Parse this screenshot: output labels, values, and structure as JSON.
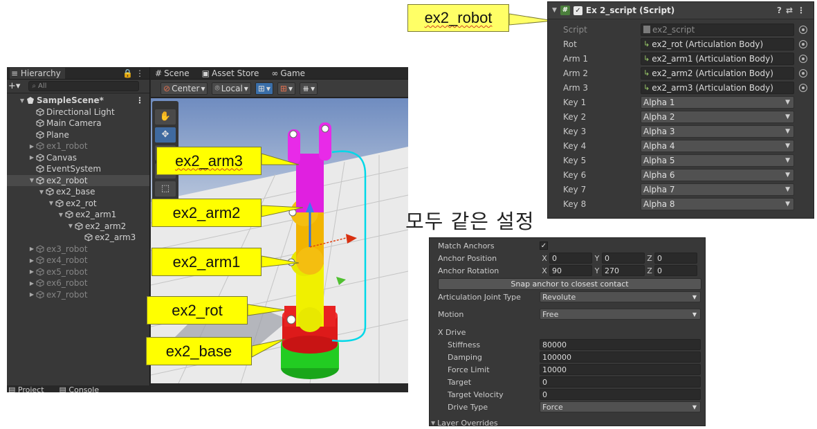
{
  "callouts": {
    "robot": "ex2_robot",
    "arm3": "ex2_arm3",
    "arm2": "ex2_arm2",
    "arm1": "ex2_arm1",
    "rot": "ex2_rot",
    "base": "ex2_base"
  },
  "annotation_text": "모두 같은 설정",
  "hierarchy": {
    "tab_label": "Hierarchy",
    "search_placeholder": "All",
    "rows": [
      {
        "label": "SampleScene*",
        "depth": 0,
        "expanded": true,
        "bold": true,
        "dim": false,
        "selected": false,
        "icon": "unity-scene-icon"
      },
      {
        "label": "Directional Light",
        "depth": 1,
        "expanded": null,
        "bold": false,
        "dim": false,
        "selected": false,
        "icon": "gameobject-cube-icon"
      },
      {
        "label": "Main Camera",
        "depth": 1,
        "expanded": null,
        "bold": false,
        "dim": false,
        "selected": false,
        "icon": "gameobject-cube-icon"
      },
      {
        "label": "Plane",
        "depth": 1,
        "expanded": null,
        "bold": false,
        "dim": false,
        "selected": false,
        "icon": "gameobject-cube-icon"
      },
      {
        "label": "ex1_robot",
        "depth": 1,
        "expanded": false,
        "bold": false,
        "dim": true,
        "selected": false,
        "icon": "gameobject-cube-icon"
      },
      {
        "label": "Canvas",
        "depth": 1,
        "expanded": false,
        "bold": false,
        "dim": false,
        "selected": false,
        "icon": "gameobject-cube-icon"
      },
      {
        "label": "EventSystem",
        "depth": 1,
        "expanded": null,
        "bold": false,
        "dim": false,
        "selected": false,
        "icon": "gameobject-cube-icon"
      },
      {
        "label": "ex2_robot",
        "depth": 1,
        "expanded": true,
        "bold": false,
        "dim": false,
        "selected": true,
        "icon": "gameobject-cube-icon"
      },
      {
        "label": "ex2_base",
        "depth": 2,
        "expanded": true,
        "bold": false,
        "dim": false,
        "selected": false,
        "icon": "gameobject-cube-icon"
      },
      {
        "label": "ex2_rot",
        "depth": 3,
        "expanded": true,
        "bold": false,
        "dim": false,
        "selected": false,
        "icon": "gameobject-cube-icon"
      },
      {
        "label": "ex2_arm1",
        "depth": 4,
        "expanded": true,
        "bold": false,
        "dim": false,
        "selected": false,
        "icon": "gameobject-cube-icon"
      },
      {
        "label": "ex2_arm2",
        "depth": 5,
        "expanded": true,
        "bold": false,
        "dim": false,
        "selected": false,
        "icon": "gameobject-cube-icon"
      },
      {
        "label": "ex2_arm3",
        "depth": 6,
        "expanded": null,
        "bold": false,
        "dim": false,
        "selected": false,
        "icon": "gameobject-cube-icon"
      },
      {
        "label": "ex3_robot",
        "depth": 1,
        "expanded": false,
        "bold": false,
        "dim": true,
        "selected": false,
        "icon": "gameobject-cube-icon"
      },
      {
        "label": "ex4_robot",
        "depth": 1,
        "expanded": false,
        "bold": false,
        "dim": true,
        "selected": false,
        "icon": "gameobject-cube-icon"
      },
      {
        "label": "ex5_robot",
        "depth": 1,
        "expanded": false,
        "bold": false,
        "dim": true,
        "selected": false,
        "icon": "gameobject-cube-icon"
      },
      {
        "label": "ex6_robot",
        "depth": 1,
        "expanded": false,
        "bold": false,
        "dim": true,
        "selected": false,
        "icon": "gameobject-cube-icon"
      },
      {
        "label": "ex7_robot",
        "depth": 1,
        "expanded": false,
        "bold": false,
        "dim": true,
        "selected": false,
        "icon": "gameobject-cube-icon"
      }
    ]
  },
  "bottom_tabs": {
    "project": "Project",
    "console": "Console"
  },
  "scene": {
    "tabs": {
      "scene": "Scene",
      "asset_store": "Asset Store",
      "game": "Game"
    },
    "toolbar": {
      "pivot": "Center",
      "space": "Local"
    },
    "arm_colors": {
      "arm3": "#e020e0",
      "arm2": "#f0b800",
      "arm1": "#f0f000",
      "rot": "#e01818",
      "base": "#20c020"
    }
  },
  "script_inspector": {
    "title": "Ex 2_script (Script)",
    "enabled": true,
    "fields": [
      {
        "label": "Script",
        "value": "ex2_script",
        "kind": "script"
      },
      {
        "label": "Rot",
        "value": "ex2_rot (Articulation Body)",
        "kind": "object"
      },
      {
        "label": "Arm 1",
        "value": "ex2_arm1 (Articulation Body)",
        "kind": "object"
      },
      {
        "label": "Arm 2",
        "value": "ex2_arm2 (Articulation Body)",
        "kind": "object"
      },
      {
        "label": "Arm 3",
        "value": "ex2_arm3 (Articulation Body)",
        "kind": "object"
      },
      {
        "label": "Key 1",
        "value": "Alpha 1",
        "kind": "dropdown"
      },
      {
        "label": "Key 2",
        "value": "Alpha 2",
        "kind": "dropdown"
      },
      {
        "label": "Key 3",
        "value": "Alpha 3",
        "kind": "dropdown"
      },
      {
        "label": "Key 4",
        "value": "Alpha 4",
        "kind": "dropdown"
      },
      {
        "label": "Key 5",
        "value": "Alpha 5",
        "kind": "dropdown"
      },
      {
        "label": "Key 6",
        "value": "Alpha 6",
        "kind": "dropdown"
      },
      {
        "label": "Key 7",
        "value": "Alpha 7",
        "kind": "dropdown"
      },
      {
        "label": "Key 8",
        "value": "Alpha 8",
        "kind": "dropdown"
      }
    ]
  },
  "articulation_inspector": {
    "match_anchors_label": "Match Anchors",
    "match_anchors": true,
    "anchor_position_label": "Anchor Position",
    "anchor_position": {
      "x": "0",
      "y": "0",
      "z": "0"
    },
    "anchor_rotation_label": "Anchor Rotation",
    "anchor_rotation": {
      "x": "90",
      "y": "270",
      "z": "0"
    },
    "snap_button": "Snap anchor to closest contact",
    "joint_type_label": "Articulation Joint Type",
    "joint_type": "Revolute",
    "motion_label": "Motion",
    "motion": "Free",
    "xdrive_label": "X Drive",
    "stiffness_label": "Stiffness",
    "stiffness": "80000",
    "damping_label": "Damping",
    "damping": "100000",
    "force_limit_label": "Force Limit",
    "force_limit": "10000",
    "target_label": "Target",
    "target": "0",
    "target_velocity_label": "Target Velocity",
    "target_velocity": "0",
    "drive_type_label": "Drive Type",
    "drive_type": "Force",
    "layer_overrides_label": "Layer Overrides"
  }
}
